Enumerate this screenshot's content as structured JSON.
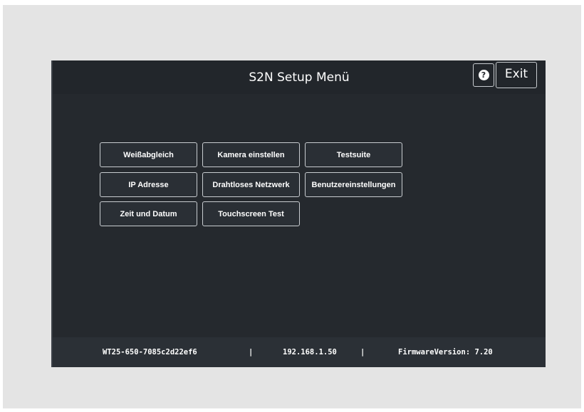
{
  "header": {
    "title": "S2N Setup Menü",
    "help_glyph": "?",
    "help_icon": "question-circle-icon",
    "exit_label": "Exit"
  },
  "menu": {
    "buttons": [
      {
        "label": "Weißabgleich"
      },
      {
        "label": "Kamera einstellen"
      },
      {
        "label": "Testsuite"
      },
      {
        "label": "IP Adresse"
      },
      {
        "label": "Drahtloses Netzwerk"
      },
      {
        "label": "Benutzereinstellungen"
      },
      {
        "label": "Zeit und Datum"
      },
      {
        "label": "Touchscreen Test"
      }
    ]
  },
  "footer": {
    "device_id": "WT25-650-7085c2d22ef6",
    "separator": "|",
    "ip_address": "192.168.1.50",
    "firmware": "FirmwareVersion: 7.20"
  },
  "colors": {
    "panel_background": "#25292e",
    "header_background": "#22262b",
    "footer_background": "#2b3036",
    "button_border": "#c8ccd0",
    "text": "#ffffff",
    "page_background": "#e4e4e4"
  }
}
